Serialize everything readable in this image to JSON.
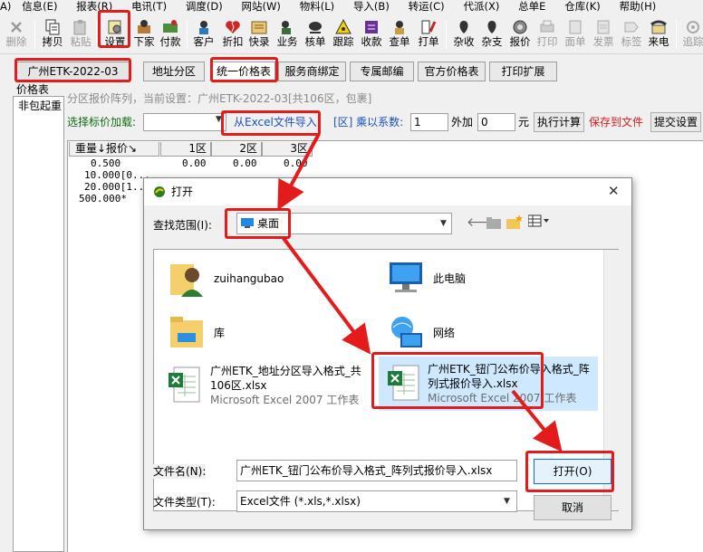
{
  "menubar": [
    "A)",
    "信息(E)",
    "报表(R)",
    "电讯(T)",
    "调度(D)",
    "网站(W)",
    "物料(L)",
    "导入(B)",
    "转运(C)",
    "代派(X)",
    "总单E",
    "仓库(K)",
    "帮助(H)"
  ],
  "toolbar": {
    "items": [
      {
        "label": "删除",
        "icon": "delete-icon",
        "disabled": true
      },
      {
        "label": "拷贝",
        "icon": "copy-icon",
        "disabled": false
      },
      {
        "label": "粘贴",
        "icon": "paste-icon",
        "disabled": true
      },
      {
        "label": "设置",
        "icon": "settings-icon",
        "disabled": false
      },
      {
        "label": "下家",
        "icon": "agent-icon",
        "disabled": false
      },
      {
        "label": "付款",
        "icon": "payment-icon",
        "disabled": false
      },
      {
        "label": "客户",
        "icon": "customer-icon",
        "disabled": false
      },
      {
        "label": "折扣",
        "icon": "discount-icon",
        "disabled": false
      },
      {
        "label": "快录",
        "icon": "quick-entry-icon",
        "disabled": false
      },
      {
        "label": "业务",
        "icon": "business-icon",
        "disabled": false
      },
      {
        "label": "核单",
        "icon": "verify-icon",
        "disabled": false
      },
      {
        "label": "跟踪",
        "icon": "track-icon",
        "disabled": false
      },
      {
        "label": "收款",
        "icon": "receipt-icon",
        "disabled": false
      },
      {
        "label": "查单",
        "icon": "search-order-icon",
        "disabled": false
      },
      {
        "label": "打单",
        "icon": "print-order-icon",
        "disabled": false
      },
      {
        "label": "杂收",
        "icon": "misc-income-icon",
        "disabled": false
      },
      {
        "label": "杂支",
        "icon": "misc-expense-icon",
        "disabled": false
      },
      {
        "label": "报价",
        "icon": "quote-icon",
        "disabled": false
      },
      {
        "label": "打印",
        "icon": "print-icon",
        "disabled": true
      },
      {
        "label": "面单",
        "icon": "waybill-icon",
        "disabled": true
      },
      {
        "label": "发票",
        "icon": "invoice-icon",
        "disabled": true
      },
      {
        "label": "标签",
        "icon": "label-icon",
        "disabled": true
      },
      {
        "label": "来电",
        "icon": "phone-icon",
        "disabled": false
      },
      {
        "label": "追踪",
        "icon": "trace-icon",
        "disabled": true
      }
    ]
  },
  "tabs": [
    "广州ETK-2022-03",
    "地址分区",
    "统一价格表",
    "服务商绑定",
    "专属邮编",
    "官方价格表",
    "打印扩展"
  ],
  "left_panel": {
    "title": "价格表",
    "row": "非包起重"
  },
  "matrix_info": "分区报价阵列，当前设置：广州ETK-2022-03[共106区，包裹]",
  "price_load": {
    "label": "选择标价加载:",
    "excel_import": "从Excel文件导入",
    "zone_multiplier": "[区] 乘以系数:",
    "multiplier": "1",
    "plus_label": "外加",
    "plus_value": "0",
    "unit": "元",
    "execute": "执行计算",
    "save": "保存到文件",
    "submit": "提交设置"
  },
  "grid": {
    "headers": [
      "重量↓报价↘",
      "1区",
      "2区",
      "3区"
    ],
    "rows": [
      [
        "0.500",
        "0.00",
        "0.00",
        "0.00"
      ],
      [
        "10.000[0...",
        "",
        "",
        ""
      ],
      [
        "20.000[1...",
        "",
        "",
        ""
      ],
      [
        "500.000*",
        "",
        "",
        ""
      ]
    ]
  },
  "dialog": {
    "title": "打开",
    "lookin_label": "查找范围(I):",
    "lookin_value": "桌面",
    "items": [
      {
        "name": "zuihangubao",
        "sub": ""
      },
      {
        "name": "此电脑",
        "sub": ""
      },
      {
        "name": "库",
        "sub": ""
      },
      {
        "name": "网络",
        "sub": ""
      },
      {
        "name": "广州ETK_地址分区导入格式_共",
        "name2": "106区.xlsx",
        "sub": "Microsoft Excel 2007 工作表"
      },
      {
        "name": "广州ETK_钮门公布价导入格式_阵",
        "name2": "列式报价导入.xlsx",
        "sub": "Microsoft Excel 2007 工作表"
      }
    ],
    "filename_label": "文件名(N):",
    "filename_value": "广州ETK_钮门公布价导入格式_阵列式报价导入.xlsx",
    "filetype_label": "文件类型(T):",
    "filetype_value": "Excel文件 (*.xls,*.xlsx)",
    "open_button": "打开(O)",
    "cancel_button": "取消",
    "close_glyph": "✕"
  }
}
